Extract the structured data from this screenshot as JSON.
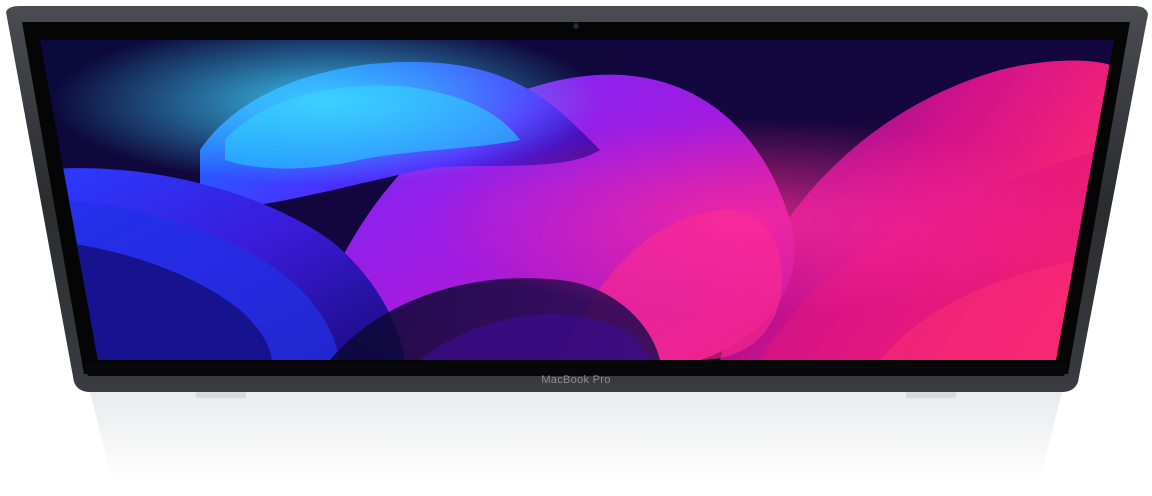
{
  "device": {
    "brand_label": "MacBook Pro",
    "frame_color": "#2c2d31",
    "bezel_color": "#050505",
    "base_color": "#dcdde0"
  },
  "wallpaper": {
    "palette": [
      "#0a0630",
      "#1a4bff",
      "#19b6ff",
      "#6a1bff",
      "#c21bd6",
      "#ff1a7a"
    ]
  }
}
